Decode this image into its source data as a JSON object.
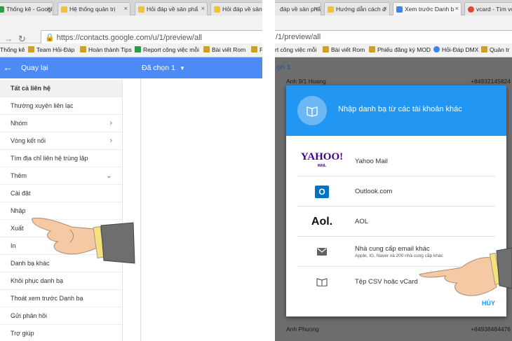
{
  "left": {
    "tabs": [
      {
        "label": "Thống kê - Google",
        "color": "#2e9b4a"
      },
      {
        "label": "Hệ thống quản trị",
        "color": "#f1c232"
      },
      {
        "label": "Hỏi đáp về sản phẩ",
        "color": "#f1c232"
      },
      {
        "label": "Hỏi đáp về sản ph",
        "color": "#f1c232"
      }
    ],
    "url": "https://contacts.google.com/u/1/preview/all",
    "bookmarks": [
      {
        "label": "Thống kê",
        "color": "#2e9b4a"
      },
      {
        "label": "Team Hỏi-Đáp",
        "color": "#c9a227"
      },
      {
        "label": "Hoàn thành Tips",
        "color": "#c9a227"
      },
      {
        "label": "Report công việc mỗi",
        "color": "#2e9b4a"
      },
      {
        "label": "Bài viết Rom",
        "color": "#c9a227"
      },
      {
        "label": "P",
        "color": "#c9a227"
      }
    ],
    "back_label": "Quay lại",
    "selected_label": "Đã chọn 1",
    "menu": [
      {
        "label": "Tất cả liên hệ",
        "chevron": ""
      },
      {
        "label": "Thường xuyên liên lạc",
        "chevron": ""
      },
      {
        "label": "Nhóm",
        "chevron": "›"
      },
      {
        "label": "Vòng kết nối",
        "chevron": "›"
      },
      {
        "label": "Tìm địa chỉ liên hệ trùng lặp",
        "chevron": ""
      },
      {
        "label": "Thêm",
        "chevron": "⌄"
      },
      {
        "label": "Cài đặt",
        "chevron": ""
      },
      {
        "label": "Nhập",
        "chevron": ""
      },
      {
        "label": "Xuất",
        "chevron": ""
      },
      {
        "label": "In",
        "chevron": ""
      },
      {
        "label": "Danh bạ khác",
        "chevron": ""
      },
      {
        "label": "Khôi phục danh bạ",
        "chevron": ""
      },
      {
        "label": "Thoát xem trước Danh bạ",
        "chevron": ""
      },
      {
        "label": "Gửi phản hồi",
        "chevron": ""
      },
      {
        "label": "Trợ giúp",
        "chevron": ""
      }
    ]
  },
  "right": {
    "tabs": [
      {
        "label": "đáp về sản phẩm",
        "color": "#f1c232"
      },
      {
        "label": "Hướng dẫn cách d",
        "color": "#f1c232"
      },
      {
        "label": "Xem trước Danh b",
        "color": "#3b82f6"
      },
      {
        "label": "vcard - Tìm vớ",
        "color": "#ea4335"
      }
    ],
    "url": "/1/preview/all",
    "bookmarks": [
      {
        "label": "rt công việc mỗi",
        "color": ""
      },
      {
        "label": "Bài viết Rom",
        "color": "#c9a227"
      },
      {
        "label": "Phiếu đăng ký MOD",
        "color": "#c9a227"
      },
      {
        "label": "Hỏi-Đáp DMX",
        "color": "#3b82f6"
      },
      {
        "label": "Quản tr",
        "color": "#c9a227"
      }
    ],
    "selected_label": "ọn 1",
    "bg_rows": [
      {
        "name": "Anh 9/1 Hoang",
        "phone": "+84932145824"
      },
      {
        "name": "Anh Phuong",
        "phone": "+84938484476"
      }
    ],
    "dialog": {
      "title": "Nhập danh bạ từ các tài khoản khác",
      "providers": [
        {
          "name": "Yahoo Mail",
          "sub": "",
          "logo": "YAHOO!",
          "logo_sub": "MAIL"
        },
        {
          "name": "Outlook.com",
          "sub": "",
          "logo": "O",
          "logo_sub": ""
        },
        {
          "name": "AOL",
          "sub": "",
          "logo": "Aol.",
          "logo_sub": ""
        },
        {
          "name": "Nhà cung cấp email khác",
          "sub": "Apple, IG, Naver và 200 nhà cung cấp khác",
          "logo": "",
          "logo_sub": ""
        },
        {
          "name": "Tệp CSV hoặc vCard",
          "sub": "",
          "logo": "",
          "logo_sub": ""
        }
      ],
      "cancel": "HỦY"
    }
  },
  "colors": {
    "accent": "#4c8bf5",
    "dialog_header": "#2196f3",
    "yahoo": "#400090",
    "outlook": "#0072c6"
  }
}
